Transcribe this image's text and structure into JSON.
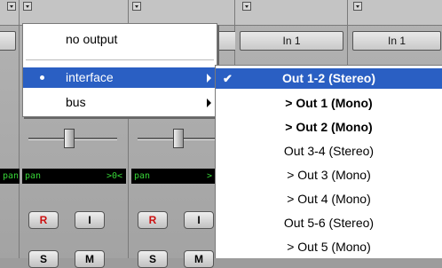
{
  "mixer": {
    "io_labels": [
      "In 1",
      "In 1"
    ],
    "pan_left": {
      "label": "pan",
      "value": ">0<"
    },
    "pan_right": {
      "label": "pan",
      "value": ">"
    },
    "buttons": {
      "record": "R",
      "input": "I",
      "solo": "S",
      "mute": "M"
    }
  },
  "output_menu": {
    "no_output": "no output",
    "interface": "interface",
    "bus": "bus"
  },
  "interface_submenu": {
    "items": [
      {
        "label": "Out 1-2 (Stereo)",
        "checked": true
      },
      {
        "label": "> Out 1 (Mono)"
      },
      {
        "label": "> Out 2 (Mono)"
      },
      {
        "label": "Out 3-4 (Stereo)"
      },
      {
        "label": "> Out 3 (Mono)"
      },
      {
        "label": "> Out 4 (Mono)"
      },
      {
        "label": "Out 5-6 (Stereo)"
      },
      {
        "label": "> Out 5 (Mono)"
      }
    ],
    "check_glyph": "✔"
  },
  "colors": {
    "highlight": "#2a5fc3",
    "pan_text": "#37d437"
  }
}
